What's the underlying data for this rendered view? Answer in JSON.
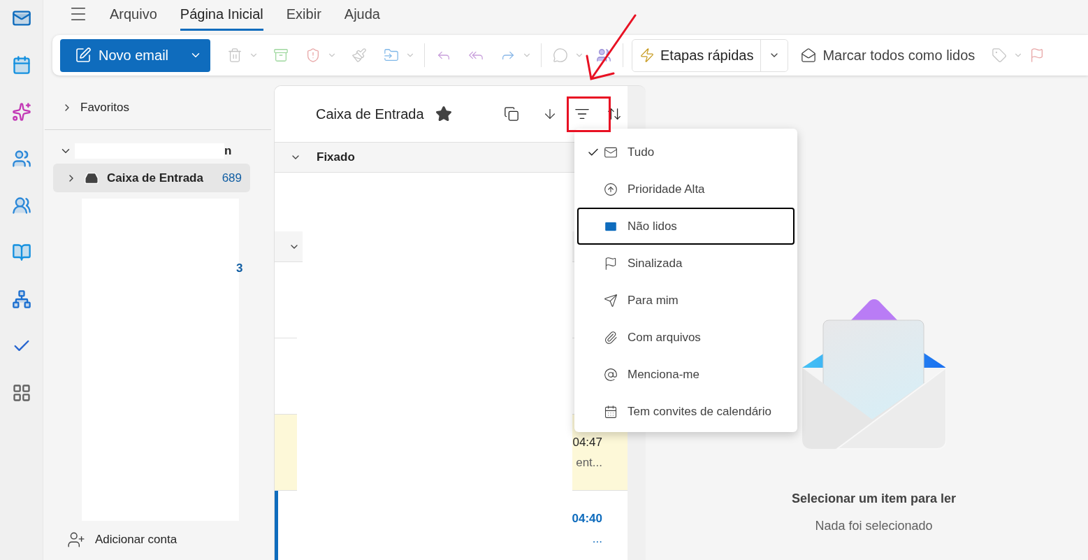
{
  "menu_bar": {
    "tabs": [
      {
        "label": "Arquivo",
        "selected": false
      },
      {
        "label": "Página Inicial",
        "selected": true
      },
      {
        "label": "Exibir",
        "selected": false
      },
      {
        "label": "Ajuda",
        "selected": false
      }
    ]
  },
  "ribbon": {
    "new_email": "Novo email",
    "quick_steps": "Etapas rápidas",
    "mark_all_read": "Marcar todos como lidos"
  },
  "folder_pane": {
    "favorites": {
      "label": "Favoritos",
      "expanded": false
    },
    "account": {
      "name_fragment": "n",
      "expanded": true
    },
    "folders": [
      {
        "label": "Caixa de Entrada",
        "count": "689",
        "selected": true,
        "expanded": false
      }
    ],
    "count_fragment": "3",
    "add_account": "Adicionar conta"
  },
  "message_list": {
    "title": "Caixa de Entrada",
    "favorite": true,
    "rows": [
      {
        "kind": "group",
        "label": "Fixado",
        "expanded": true
      },
      {
        "kind": "group",
        "expanded": true
      },
      {
        "kind": "message",
        "highlighted": false,
        "selected": false
      },
      {
        "kind": "message",
        "highlighted": false,
        "selected": false
      },
      {
        "kind": "message",
        "highlighted": true,
        "selected": false,
        "unread": false,
        "time": "04:47",
        "preview": "ent..."
      },
      {
        "kind": "message",
        "highlighted": false,
        "selected": true,
        "unread": true,
        "time": "04:40",
        "preview": "..."
      }
    ]
  },
  "filter_menu": {
    "items": [
      {
        "label": "Tudo",
        "checked": true,
        "focused": false
      },
      {
        "label": "Prioridade Alta",
        "checked": false,
        "focused": false
      },
      {
        "label": "Não lidos",
        "checked": false,
        "focused": true
      },
      {
        "label": "Sinalizada",
        "checked": false,
        "focused": false
      },
      {
        "label": "Para mim",
        "checked": false,
        "focused": false
      },
      {
        "label": "Com arquivos",
        "checked": false,
        "focused": false
      },
      {
        "label": "Menciona-me",
        "checked": false,
        "focused": false
      },
      {
        "label": "Tem convites de calendário",
        "checked": false,
        "focused": false
      }
    ]
  },
  "reading_pane": {
    "title": "Selecionar um item para ler",
    "subtitle": "Nada foi selecionado"
  }
}
